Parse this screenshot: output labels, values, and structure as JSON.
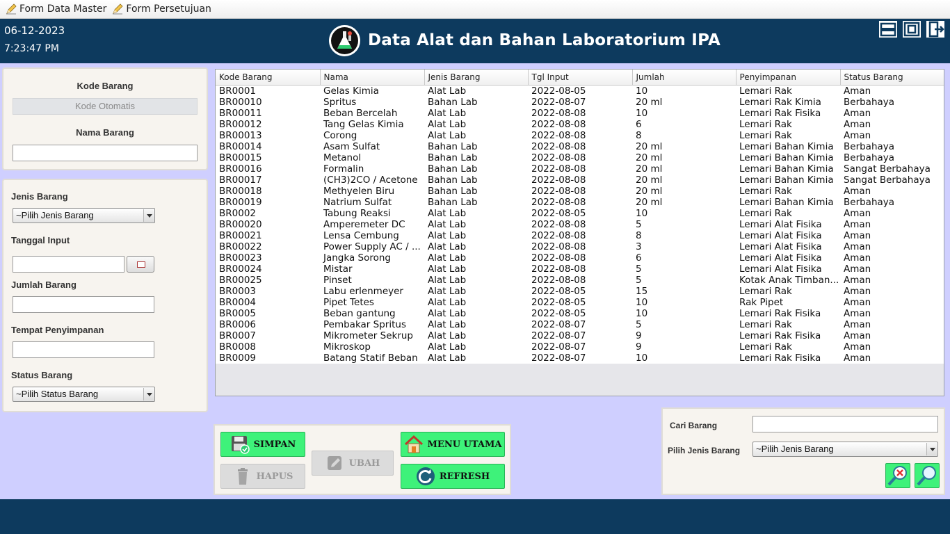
{
  "menubar": {
    "items": [
      {
        "label": "Form Data Master",
        "icon": "pencil-icon"
      },
      {
        "label": "Form Persetujuan",
        "icon": "pencil-icon"
      }
    ]
  },
  "header": {
    "date": "06-12-2023",
    "time": "7:23:47 PM",
    "title": "Data Alat dan Bahan Laboratorium IPA",
    "colors": {
      "header_bg": "#0d3a5e",
      "page_bg": "#cfcfff",
      "button_green": "#3ef27a"
    }
  },
  "form": {
    "kode_label": "Kode Barang",
    "kode_value": "Kode Otomatis",
    "nama_label": "Nama Barang",
    "nama_value": "",
    "jenis_label": "Jenis Barang",
    "jenis_value": "~Pilih Jenis Barang",
    "tanggal_label": "Tanggal Input",
    "tanggal_value": "",
    "jumlah_label": "Jumlah Barang",
    "jumlah_value": "",
    "tempat_label": "Tempat Penyimpanan",
    "tempat_value": "",
    "status_label": "Status Barang",
    "status_value": "~Pilih Status Barang"
  },
  "table": {
    "columns": [
      "Kode Barang",
      "Nama",
      "Jenis Barang",
      "Tgl Input",
      "Jumlah",
      "Penyimpanan",
      "Status Barang"
    ],
    "rows": [
      [
        "BR0001",
        "Gelas Kimia",
        "Alat Lab",
        "2022-08-05",
        "10",
        "Lemari Rak",
        "Aman"
      ],
      [
        "BR00010",
        "Spritus",
        "Bahan Lab",
        "2022-08-07",
        "20 ml",
        "Lemari Rak Kimia",
        "Berbahaya"
      ],
      [
        "BR00011",
        "Beban Bercelah",
        "Alat Lab",
        "2022-08-08",
        "10",
        "Lemari Rak Fisika",
        "Aman"
      ],
      [
        "BR00012",
        "Tang Gelas Kimia",
        "Alat Lab",
        "2022-08-08",
        "6",
        "Lemari Rak",
        "Aman"
      ],
      [
        "BR00013",
        "Corong",
        "Alat Lab",
        "2022-08-08",
        "8",
        "Lemari Rak",
        "Aman"
      ],
      [
        "BR00014",
        "Asam Sulfat",
        "Bahan Lab",
        "2022-08-08",
        "20 ml",
        "Lemari Bahan Kimia",
        "Berbahaya"
      ],
      [
        "BR00015",
        "Metanol",
        "Bahan Lab",
        "2022-08-08",
        "20 ml",
        "Lemari Bahan Kimia",
        "Berbahaya"
      ],
      [
        "BR00016",
        "Formalin",
        "Bahan Lab",
        "2022-08-08",
        "20 ml",
        "Lemari Bahan Kimia",
        "Sangat Berbahaya"
      ],
      [
        "BR00017",
        "(CH3)2CO / Acetone",
        "Bahan Lab",
        "2022-08-08",
        "20 ml",
        "Lemari Bahan Kimia",
        "Sangat Berbahaya"
      ],
      [
        "BR00018",
        "Methyelen Biru",
        "Bahan Lab",
        "2022-08-08",
        "20 ml",
        "Lemari Rak",
        "Aman"
      ],
      [
        "BR00019",
        "Natrium Sulfat",
        "Bahan Lab",
        "2022-08-08",
        "20 ml",
        "Lemari Bahan Kimia",
        "Berbahaya"
      ],
      [
        "BR0002",
        "Tabung Reaksi",
        "Alat Lab",
        "2022-08-05",
        "10",
        "Lemari Rak",
        "Aman"
      ],
      [
        "BR00020",
        "Amperemeter DC",
        "Alat Lab",
        "2022-08-08",
        "5",
        "Lemari Alat Fisika",
        "Aman"
      ],
      [
        "BR00021",
        "Lensa Cembung",
        "Alat Lab",
        "2022-08-08",
        "8",
        "Lemari Alat Fisika",
        "Aman"
      ],
      [
        "BR00022",
        "Power Supply AC / ...",
        "Alat Lab",
        "2022-08-08",
        "3",
        "Lemari Alat Fisika",
        "Aman"
      ],
      [
        "BR00023",
        "Jangka Sorong",
        "Alat Lab",
        "2022-08-08",
        "6",
        "Lemari Alat Fisika",
        "Aman"
      ],
      [
        "BR00024",
        "Mistar",
        "Alat Lab",
        "2022-08-08",
        "5",
        "Lemari Alat Fisika",
        "Aman"
      ],
      [
        "BR00025",
        "Pinset",
        "Alat Lab",
        "2022-08-08",
        "5",
        "Kotak Anak Timban...",
        "Aman"
      ],
      [
        "BR0003",
        "Labu erlenmeyer",
        "Alat Lab",
        "2022-08-05",
        "15",
        "Lemari Rak",
        "Aman"
      ],
      [
        "BR0004",
        "Pipet Tetes",
        "Alat Lab",
        "2022-08-05",
        "10",
        "Rak Pipet",
        "Aman"
      ],
      [
        "BR0005",
        "Beban gantung",
        "Alat Lab",
        "2022-08-05",
        "10",
        "Lemari Rak Fisika",
        "Aman"
      ],
      [
        "BR0006",
        "Pembakar Spritus",
        "Alat Lab",
        "2022-08-07",
        "5",
        "Lemari Rak",
        "Aman"
      ],
      [
        "BR0007",
        "Mikrometer Sekrup",
        "Alat Lab",
        "2022-08-07",
        "9",
        "Lemari Rak Fisika",
        "Aman"
      ],
      [
        "BR0008",
        "Mikroskop",
        "Alat Lab",
        "2022-08-07",
        "9",
        "Lemari Rak",
        "Aman"
      ],
      [
        "BR0009",
        "Batang Statif Beban",
        "Alat Lab",
        "2022-08-07",
        "10",
        "Lemari Rak Fisika",
        "Aman"
      ]
    ]
  },
  "buttons": {
    "simpan": "SIMPAN",
    "hapus": "HAPUS",
    "ubah": "UBAH",
    "menu_utama": "MENU UTAMA",
    "refresh": "REFRESH"
  },
  "search": {
    "cari_label": "Cari Barang",
    "cari_value": "",
    "jenis_label": "Pilih Jenis Barang",
    "jenis_value": "~Pilih Jenis Barang"
  }
}
